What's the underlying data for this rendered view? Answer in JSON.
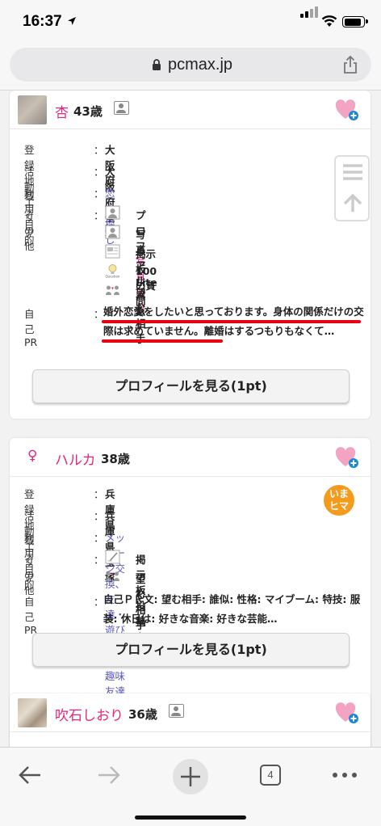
{
  "status": {
    "time": "16:37"
  },
  "browser": {
    "url": "pcmax.jp",
    "tab_count": "4"
  },
  "cards": [
    {
      "name": "杏",
      "age": "43歳",
      "fields": [
        {
          "label": "登録地域",
          "value": "大阪府"
        },
        {
          "label": "活動エリア",
          "value": "大阪府全域"
        },
        {
          "label": "利用目的",
          "value": "恋人探し"
        }
      ],
      "other_label": "その他",
      "other_items": [
        {
          "icon": "profile-photo-icon",
          "text": "プロフ",
          "accent": "写真あり"
        },
        {
          "icon": "photo-album-icon",
          "text": "写真アルバム",
          "accent": "1"
        },
        {
          "icon": "bulletin-lite-icon",
          "text": "掲示板Lite",
          "accent": ""
        },
        {
          "icon": "question-bulb-icon",
          "text": "100の質問",
          "accent": ""
        },
        {
          "icon": "desired-partner-icon",
          "text": "望む相手",
          "accent": ""
        }
      ],
      "pr_label": "自己PR",
      "pr_text": "婚外恋愛をしたいと思っております。身体の関係だけの交際は求めていません。離婚はするつもりもなくて…",
      "button": "プロフィールを見る(1pt)"
    },
    {
      "name": "ハルカ",
      "age": "38歳",
      "gender_symbol": "♀",
      "badge": "いまヒマ",
      "fields": [
        {
          "label": "登録地域",
          "value": "兵庫県"
        },
        {
          "label": "活動エリア",
          "value": "兵庫県宝塚"
        },
        {
          "label": "利用目的",
          "value": "メッセージ交換、 友達・遊び相手、 趣味友達"
        }
      ],
      "other_label": "その他",
      "other_items": [
        {
          "icon": "bulletin-post-icon",
          "text": "掲示板投稿",
          "accent": "あり"
        },
        {
          "icon": "desired-partner-icon",
          "text": "望む相手",
          "accent": ""
        }
      ],
      "pr_label": "自己PR",
      "pr_text": "自己ＰＲ文: 望む相手: 誰似: 性格: マイブーム: 特技: 服装: 休日は: 好きな音楽: 好きな芸能…",
      "button": "プロフィールを見る(1pt)"
    },
    {
      "name": "吹石しおり",
      "age": "36歳"
    }
  ],
  "colors": {
    "name_pink": "#e4267d",
    "link_blue": "#5a58c2",
    "underline_red": "#e60012",
    "badge_orange": "#f49a1c"
  }
}
